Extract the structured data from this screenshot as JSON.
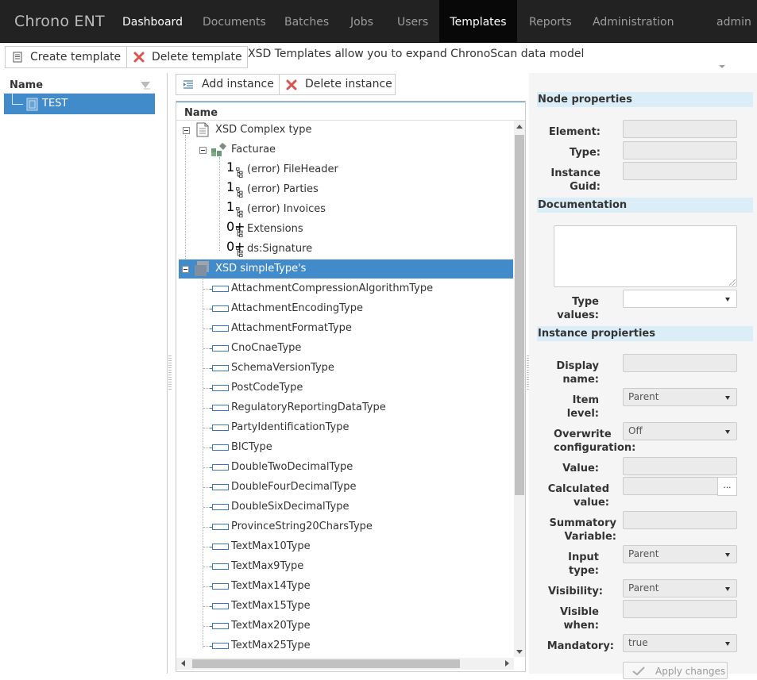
{
  "navbar": {
    "brand": "Chrono ENT",
    "items": [
      {
        "label": "Dashboard"
      },
      {
        "label": "Documents"
      },
      {
        "label": "Batches"
      },
      {
        "label": "Jobs"
      },
      {
        "label": "Users"
      },
      {
        "label": "Templates"
      },
      {
        "label": "Reports"
      },
      {
        "label": "Administration"
      }
    ],
    "user": "admin"
  },
  "toolbar": {
    "create_template": "Create template",
    "delete_template": "Delete template",
    "info": "XSD Templates allow you to expand ChronoScan data model"
  },
  "templates_list": {
    "header": "Name",
    "items": [
      {
        "label": "TEST"
      }
    ]
  },
  "instance_toolbar": {
    "add_instance": "Add instance",
    "delete_instance": "Delete instance"
  },
  "tree": {
    "header": "Name",
    "complex_root": "XSD Complex type",
    "facturae": "Facturae",
    "facturae_children": [
      {
        "mult": "1",
        "label": "(error) FileHeader"
      },
      {
        "mult": "1",
        "label": "(error) Parties"
      },
      {
        "mult": "1",
        "label": "(error) Invoices"
      },
      {
        "mult": "0+",
        "label": "Extensions"
      },
      {
        "mult": "0+",
        "label": "ds:Signature"
      }
    ],
    "simple_root": "XSD simpleType's",
    "simple_types": [
      {
        "label": "AttachmentCompressionAlgorithmType"
      },
      {
        "label": "AttachmentEncodingType"
      },
      {
        "label": "AttachmentFormatType"
      },
      {
        "label": "CnoCnaeType"
      },
      {
        "label": "SchemaVersionType"
      },
      {
        "label": "PostCodeType"
      },
      {
        "label": "RegulatoryReportingDataType"
      },
      {
        "label": "PartyIdentificationType"
      },
      {
        "label": "BICType"
      },
      {
        "label": "DoubleTwoDecimalType"
      },
      {
        "label": "DoubleFourDecimalType"
      },
      {
        "label": "DoubleSixDecimalType"
      },
      {
        "label": "ProvinceString20CharsType"
      },
      {
        "label": "TextMax10Type"
      },
      {
        "label": "TextMax9Type"
      },
      {
        "label": "TextMax14Type"
      },
      {
        "label": "TextMax15Type"
      },
      {
        "label": "TextMax20Type"
      },
      {
        "label": "TextMax25Type"
      }
    ]
  },
  "properties": {
    "node_header": "Node properties",
    "element_label": "Element:",
    "type_label": "Type:",
    "instance_guid_label_1": "Instance",
    "instance_guid_label_2": "Guid:",
    "documentation_header": "Documentation",
    "type_values_label_1": "Type",
    "type_values_label_2": "values:",
    "instance_header": "Instance propierties",
    "display_name_label_1": "Display",
    "display_name_label_2": "name:",
    "item_level_label_1": "Item",
    "item_level_label_2": "level:",
    "item_level_value": "Parent",
    "overwrite_label_1": "Overwrite",
    "overwrite_label_2": "configuration:",
    "overwrite_value": "Off",
    "value_label": "Value:",
    "calculated_label_1": "Calculated",
    "calculated_label_2": "value:",
    "calc_button": "...",
    "summatory_label_1": "Summatory",
    "summatory_label_2": "Variable:",
    "input_type_label_1": "Input",
    "input_type_label_2": "type:",
    "input_type_value": "Parent",
    "visibility_label": "Visibility:",
    "visibility_value": "Parent",
    "visible_when_label_1": "Visible",
    "visible_when_label_2": "when:",
    "mandatory_label": "Mandatory:",
    "mandatory_value": "true",
    "apply_button": "Apply changes"
  },
  "colors": {
    "navbar_bg": "#222222",
    "active_tab_bg": "#080808",
    "selection": "#428bca",
    "section_header": "#dbeef8"
  }
}
